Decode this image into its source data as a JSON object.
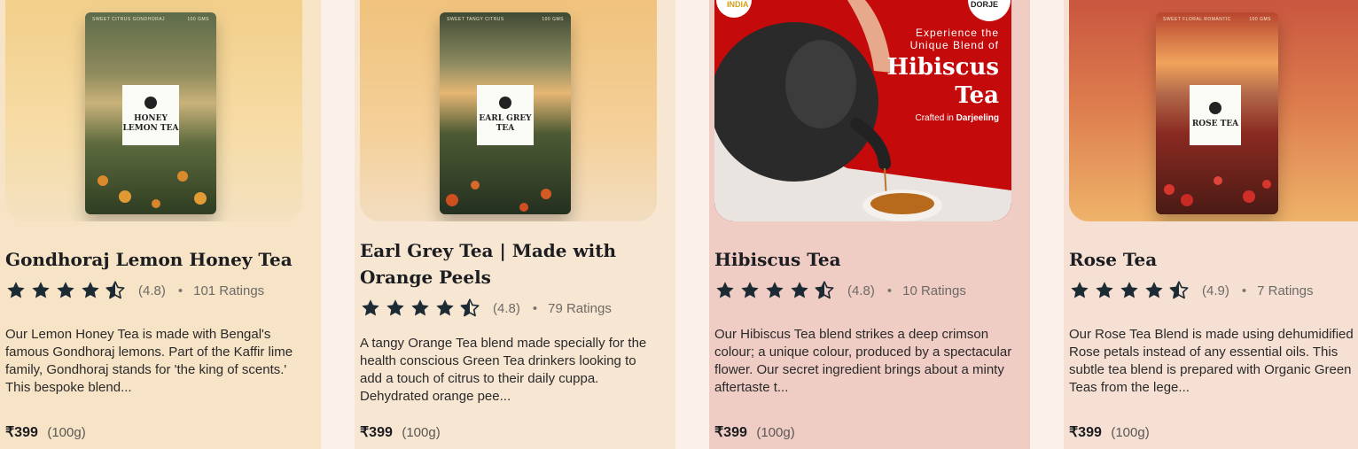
{
  "products": [
    {
      "title": "Gondhoraj Lemon Honey Tea",
      "rating": "(4.8)",
      "ratings_count": "101 Ratings",
      "description": "Our Lemon Honey Tea is made with Bengal's famous Gondhoraj lemons. Part of the Kaffir lime family, Gondhoraj stands for 'the king of scents.' This bespoke blend...",
      "price": "₹399",
      "weight": "(100g)",
      "pack_label": "HONEY LEMON TEA",
      "pack_tag": "SWEET CITRUS GONDHORAJ",
      "pack_weight": "100 GMS"
    },
    {
      "title": "Earl Grey Tea | Made with Orange Peels",
      "rating": "(4.8)",
      "ratings_count": "79 Ratings",
      "description": "A tangy Orange Tea blend made specially for the health conscious Green Tea drinkers looking to add a touch of citrus to their daily cuppa. Dehydrated orange pee...",
      "price": "₹399",
      "weight": "(100g)",
      "pack_label": "EARL GREY TEA",
      "pack_tag": "SWEET TANGY CITRUS",
      "pack_weight": "100 GMS"
    },
    {
      "title": "Hibiscus Tea",
      "rating": "(4.8)",
      "ratings_count": "10 Ratings",
      "description": "Our Hibiscus Tea blend strikes a deep crimson colour; a unique colour, produced by a spectacular flower. Our secret ingredient brings about a minty aftertaste t...",
      "price": "₹399",
      "weight": "(100g)",
      "promo_line1": "Experience the",
      "promo_line2": "Unique Blend of",
      "promo_big1": "Hibiscus",
      "promo_big2": "Tea",
      "promo_crafted": "Crafted in",
      "promo_place": "Darjeeling",
      "badge_left": "INDIA",
      "badge_right": "DORJE"
    },
    {
      "title": "Rose Tea",
      "rating": "(4.9)",
      "ratings_count": "7 Ratings",
      "description": "Our Rose Tea Blend is made using dehumidified Rose petals instead of any essential oils. This subtle tea blend is prepared with Organic Green Teas from the lege...",
      "price": "₹399",
      "weight": "(100g)",
      "pack_label": "ROSE TEA",
      "pack_tag": "SWEET FLORAL ROMANTIC",
      "pack_weight": "100 GMS"
    }
  ],
  "colors": {
    "card1_bg": "#f7e3c6",
    "card2_bg": "#f7e6d2",
    "card3_bg": "#efccc4",
    "card4_bg": "#f6e0d3",
    "text_dark": "#1b1d21",
    "star": "#1b2a33",
    "promo_red": "#c40a0a"
  },
  "icons": {
    "star": "star-icon",
    "half_star": "star-half-icon"
  },
  "rating_stars": 4.5
}
